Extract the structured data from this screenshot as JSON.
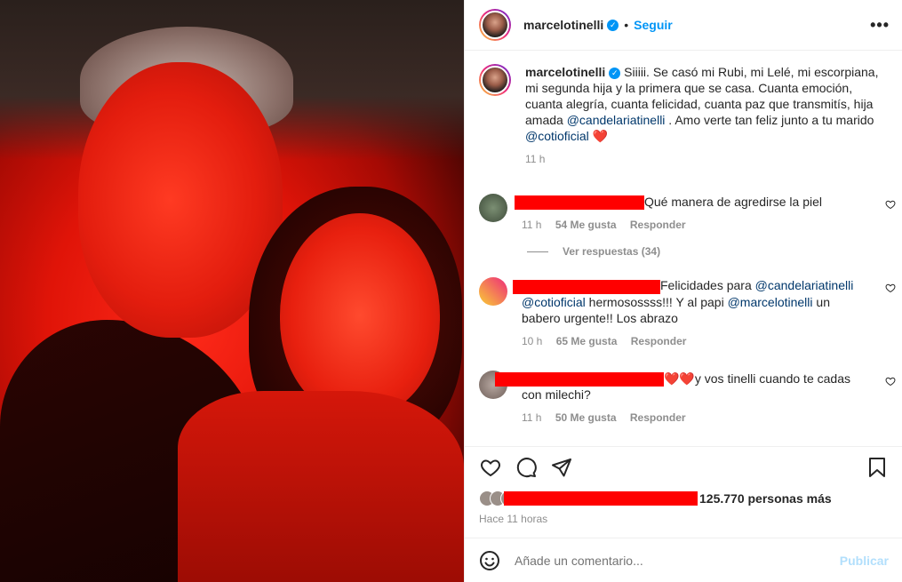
{
  "header": {
    "username": "marcelotinelli",
    "separator": "•",
    "follow_label": "Seguir",
    "more_label": "•••"
  },
  "caption": {
    "username": "marcelotinelli",
    "text_1": "Siiiii. Se casó mi Rubi, mi Lelé, mi escorpiana, mi segunda hija y la primera que se casa. Cuanta emoción, cuanta alegría, cuanta felicidad, cuanta paz que transmitís, hija amada ",
    "mention_1": "@candelariatinelli",
    "text_2": " . Amo verte tan feliz junto a tu marido ",
    "mention_2": "@cotioficial",
    "emoji": "❤️",
    "time": "11 h"
  },
  "comments": [
    {
      "text": "Qué manera de agredirse la piel",
      "time": "11 h",
      "likes": "54 Me gusta",
      "reply": "Responder",
      "view_replies": "Ver respuestas (34)"
    },
    {
      "text_1": "Felicidades para ",
      "mention_1": "@candelariatinelli",
      "mention_2": "@cotioficial",
      "text_2": " hermosossss!!! Y al papi ",
      "mention_3": "@marcelotinelli",
      "text_3": " un babero urgente!! Los abrazo",
      "time": "10 h",
      "likes": "65 Me gusta",
      "reply": "Responder"
    },
    {
      "emoji": "❤️❤️",
      "text": "y vos tinelli cuando te cadas con milechi?",
      "time": "11 h",
      "likes": "50 Me gusta",
      "reply": "Responder"
    }
  ],
  "likes": {
    "count": "125.770 personas más"
  },
  "posted": "Hace 11 horas",
  "add_comment": {
    "placeholder": "Añade un comentario...",
    "publish": "Publicar"
  },
  "colors": {
    "accent": "#0095f6",
    "mention": "#00376b",
    "redaction": "#ff0000",
    "muted": "#8e8e8e"
  }
}
